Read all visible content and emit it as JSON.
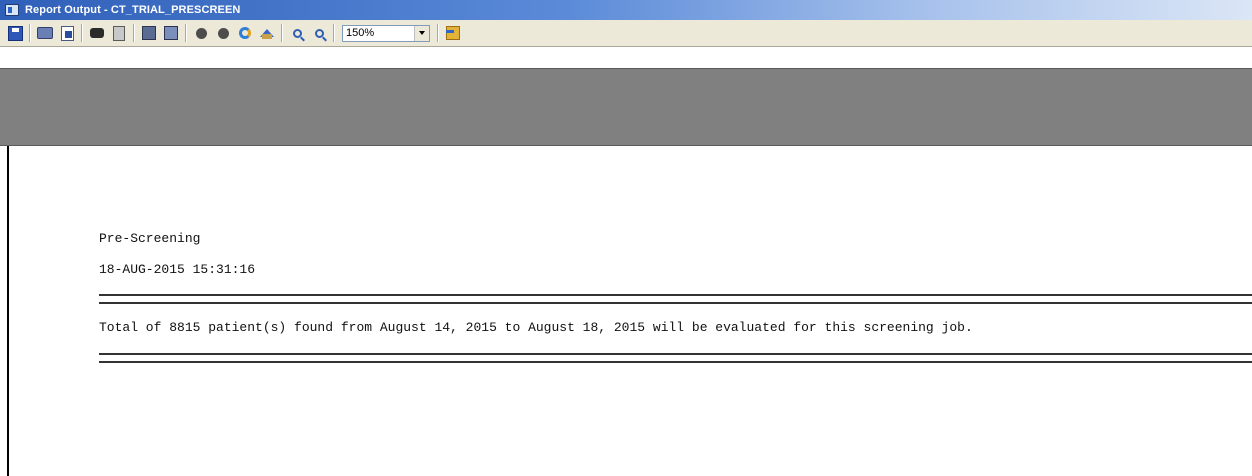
{
  "window": {
    "title": "Report Output - CT_TRIAL_PRESCREEN"
  },
  "toolbar": {
    "buttons": [
      {
        "name": "save-icon"
      },
      {
        "name": "print-icon"
      },
      {
        "name": "print-preview-icon"
      },
      {
        "name": "find-icon"
      },
      {
        "name": "document-icon"
      },
      {
        "name": "first-page-icon"
      },
      {
        "name": "next-page-icon"
      },
      {
        "name": "stop-icon"
      },
      {
        "name": "record-icon"
      },
      {
        "name": "refresh-icon"
      },
      {
        "name": "home-icon"
      },
      {
        "name": "zoom-out-icon"
      },
      {
        "name": "zoom-in-icon"
      },
      {
        "name": "exit-icon"
      }
    ],
    "zoom_value": "150%"
  },
  "report": {
    "title": "Pre-Screening",
    "timestamp": "18-AUG-2015 15:31:16",
    "summary": "Total of 8815 patient(s) found from August 14, 2015 to August 18, 2015 will be evaluated for this screening job."
  }
}
